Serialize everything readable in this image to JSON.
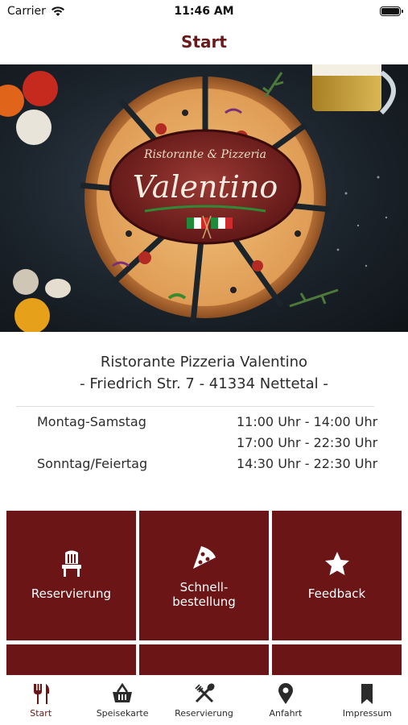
{
  "status": {
    "carrier": "Carrier",
    "time": "11:46 AM"
  },
  "nav": {
    "title": "Start"
  },
  "hero": {
    "logo_top": "Ristorante & Pizzeria",
    "logo_name": "Valentino"
  },
  "info": {
    "name": "Ristorante Pizzeria Valentino",
    "address": "- Friedrich Str. 7 - 41334 Nettetal -"
  },
  "hours": [
    {
      "day": "Montag-Samstag",
      "time": "11:00 Uhr - 14:00 Uhr"
    },
    {
      "day": "",
      "time": "17:00 Uhr - 22:30 Uhr"
    },
    {
      "day": "Sonntag/Feiertag",
      "time": "14:30 Uhr - 22:30 Uhr"
    }
  ],
  "tiles": [
    {
      "label": "Reservierung",
      "icon": "chair-icon"
    },
    {
      "label": "Schnell-\nbestellung",
      "icon": "pizza-slice-icon"
    },
    {
      "label": "Feedback",
      "icon": "star-icon"
    }
  ],
  "tabs": [
    {
      "label": "Start",
      "icon": "cutlery-icon"
    },
    {
      "label": "Speisekarte",
      "icon": "basket-icon"
    },
    {
      "label": "Reservierung",
      "icon": "crossed-utensils-icon"
    },
    {
      "label": "Anfahrt",
      "icon": "map-pin-icon"
    },
    {
      "label": "Impressum",
      "icon": "bookmark-icon"
    }
  ],
  "colors": {
    "brand": "#6b1517",
    "title": "#6b1a1c"
  }
}
